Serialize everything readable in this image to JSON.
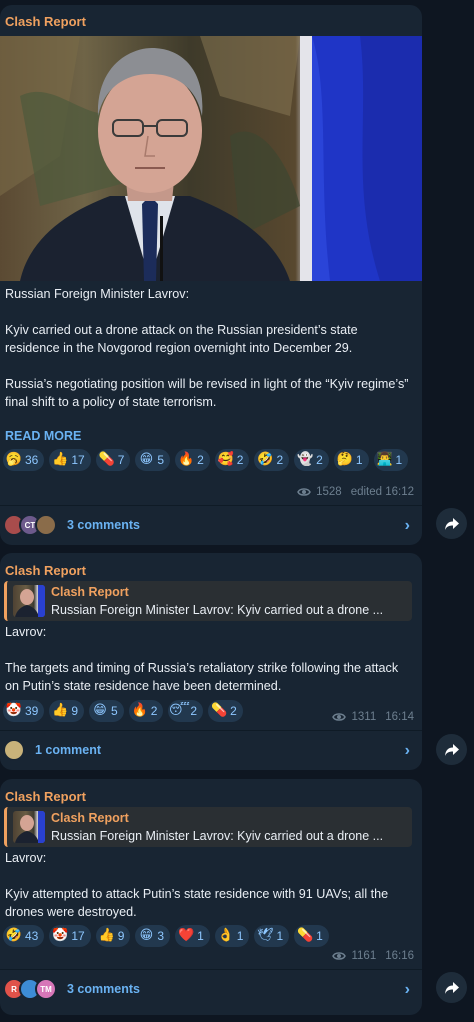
{
  "colors": {
    "background": "#0e1621",
    "bubble": "#182533",
    "channel_name": "#f0a15f",
    "link": "#6ab2f2",
    "reaction_chip": "#22384e",
    "reaction_count": "#8ec7ff",
    "meta": "#6d7f8f"
  },
  "messages": [
    {
      "channel": "Clash Report",
      "text": "Russian Foreign Minister Lavrov:\n\nKyiv carried out a drone attack on the Russian president’s state residence in the Novgorod region overnight into December 29.\n\nRussia’s negotiating position will be revised in light of the “Kyiv regime’s” final shift to a policy of state terrorism.",
      "read_more": "READ MORE",
      "reactions": [
        {
          "icon": "yawning-face",
          "glyph": "🥱",
          "count": "36"
        },
        {
          "icon": "thumbs-up",
          "glyph": "👍",
          "count": "17"
        },
        {
          "icon": "pill",
          "glyph": "💊",
          "count": "7"
        },
        {
          "icon": "grinning-face",
          "glyph": "😁",
          "count": "5"
        },
        {
          "icon": "fire",
          "glyph": "🔥",
          "count": "2"
        },
        {
          "icon": "smiling-hearts",
          "glyph": "🥰",
          "count": "2"
        },
        {
          "icon": "rofl",
          "glyph": "🤣",
          "count": "2"
        },
        {
          "icon": "ghost",
          "glyph": "👻",
          "count": "2"
        },
        {
          "icon": "thinking-face",
          "glyph": "🤔",
          "count": "1"
        },
        {
          "icon": "technologist",
          "glyph": "👨‍💻",
          "count": "1"
        }
      ],
      "views": "1528",
      "time": "edited 16:12",
      "comments": "3 comments",
      "avatars": [
        {
          "label": "",
          "color": "#a84c4c"
        },
        {
          "label": "CT",
          "color": "#6d5a8c"
        },
        {
          "label": "",
          "color": "#8a6c4a"
        }
      ]
    },
    {
      "channel": "Clash Report",
      "reply_name": "Clash Report",
      "reply_text": "Russian Foreign Minister Lavrov:  Kyiv carried out a drone ...",
      "text": "Lavrov:\n\nThe targets and timing of Russia’s retaliatory strike following the attack on Putin’s state residence have been determined.",
      "reactions": [
        {
          "icon": "clown-face",
          "glyph": "🤡",
          "count": "39"
        },
        {
          "icon": "thumbs-up",
          "glyph": "👍",
          "count": "9"
        },
        {
          "icon": "grinning-face",
          "glyph": "😁",
          "count": "5"
        },
        {
          "icon": "fire",
          "glyph": "🔥",
          "count": "2"
        },
        {
          "icon": "sleeping-face",
          "glyph": "😴",
          "count": "2"
        },
        {
          "icon": "pill",
          "glyph": "💊",
          "count": "2"
        }
      ],
      "views": "1311",
      "time": "16:14",
      "comments": "1 comment",
      "avatars": [
        {
          "label": "",
          "color": "#c8b27a"
        }
      ]
    },
    {
      "channel": "Clash Report",
      "reply_name": "Clash Report",
      "reply_text": "Russian Foreign Minister Lavrov:  Kyiv carried out a drone ...",
      "text": "Lavrov:\n\nKyiv attempted to attack Putin’s state residence with 91 UAVs; all the drones were destroyed.",
      "reactions": [
        {
          "icon": "rofl",
          "glyph": "🤣",
          "count": "43"
        },
        {
          "icon": "clown-face",
          "glyph": "🤡",
          "count": "17"
        },
        {
          "icon": "thumbs-up",
          "glyph": "👍",
          "count": "9"
        },
        {
          "icon": "grinning-face",
          "glyph": "😁",
          "count": "3"
        },
        {
          "icon": "red-heart",
          "glyph": "❤️",
          "count": "1"
        },
        {
          "icon": "ok-hand",
          "glyph": "👌",
          "count": "1"
        },
        {
          "icon": "dove",
          "glyph": "🕊",
          "count": "1"
        },
        {
          "icon": "pill",
          "glyph": "💊",
          "count": "1"
        }
      ],
      "views": "1161",
      "time": "16:16",
      "comments": "3 comments",
      "avatars": [
        {
          "label": "R",
          "color": "#e0524a"
        },
        {
          "label": "",
          "color": "#3d8cd6"
        },
        {
          "label": "TM",
          "color": "#d776b8"
        }
      ]
    }
  ]
}
